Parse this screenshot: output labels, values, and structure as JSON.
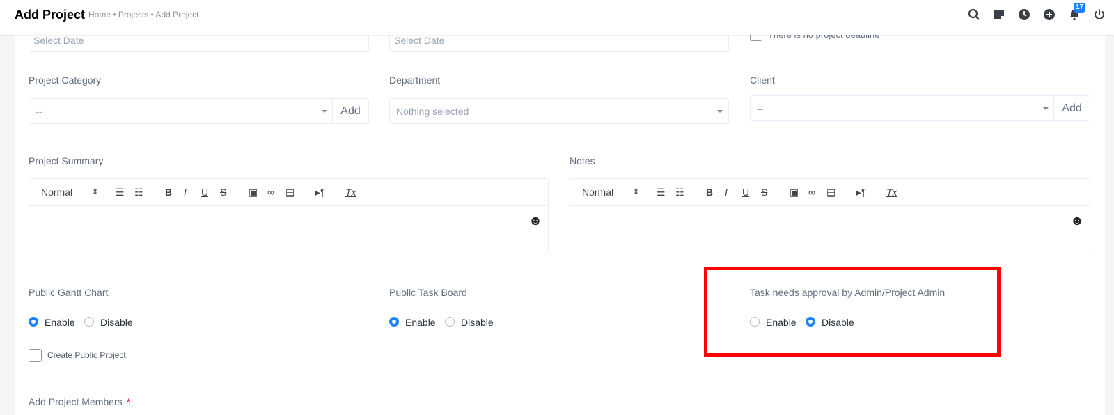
{
  "topbar": {
    "title": "Add Project",
    "breadcrumb": "Home • Projects • Add Project",
    "notifications_count": "17",
    "icons": [
      "search-icon",
      "sticky-note-icon",
      "clock-icon",
      "plus-circle-icon",
      "bell-icon",
      "power-icon"
    ]
  },
  "dates": {
    "start_placeholder": "Select Date",
    "deadline_placeholder": "Select Date",
    "no_deadline_label": "There is no project deadline"
  },
  "project_category": {
    "label": "Project Category",
    "value": "--",
    "add_label": "Add"
  },
  "department": {
    "label": "Department",
    "value": "Nothing selected"
  },
  "client": {
    "label": "Client",
    "value": "--",
    "add_label": "Add"
  },
  "project_summary": {
    "label": "Project Summary",
    "format": "Normal"
  },
  "notes": {
    "label": "Notes",
    "format": "Normal"
  },
  "public_gantt": {
    "label": "Public Gantt Chart",
    "enable": "Enable",
    "disable": "Disable",
    "selected": "Enable"
  },
  "public_task_board": {
    "label": "Public Task Board",
    "enable": "Enable",
    "disable": "Disable",
    "selected": "Enable"
  },
  "task_approval": {
    "label": "Task needs approval by Admin/Project Admin",
    "enable": "Enable",
    "disable": "Disable",
    "selected": "Disable"
  },
  "create_public_project": {
    "label": "Create Public Project"
  },
  "add_members": {
    "label": "Add Project Members",
    "required_mark": "*"
  },
  "colors": {
    "accent": "#1d82f5",
    "highlight": "#ff0000"
  }
}
